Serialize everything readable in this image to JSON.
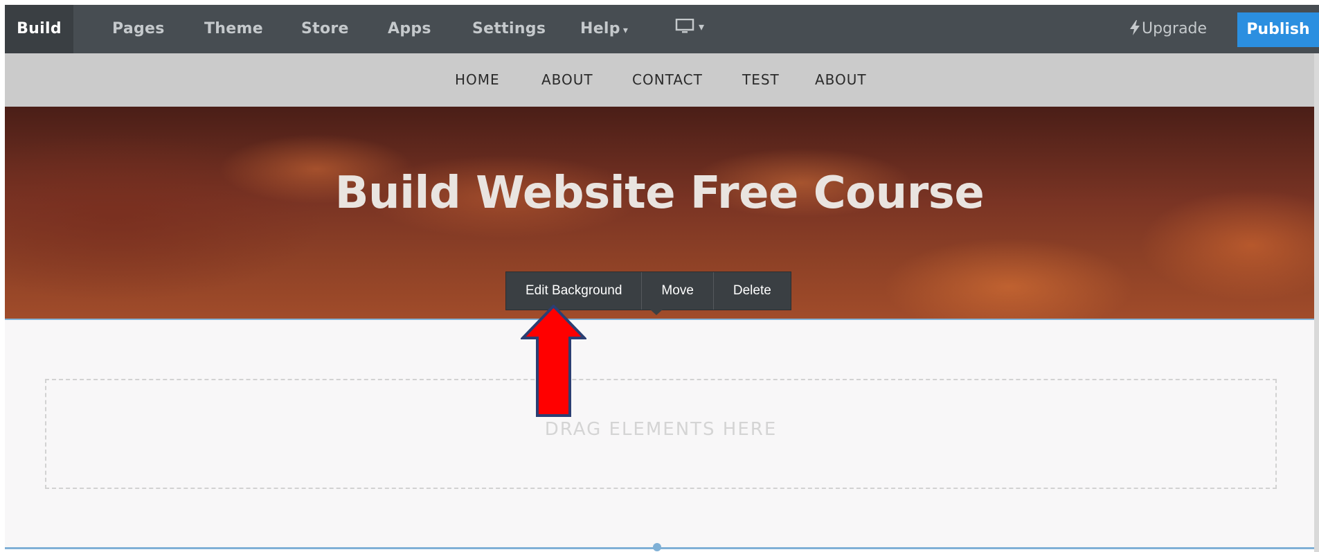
{
  "toolbar": {
    "tabs": [
      {
        "label": "Build",
        "active": true
      },
      {
        "label": "Pages"
      },
      {
        "label": "Theme"
      },
      {
        "label": "Store"
      },
      {
        "label": "Apps"
      },
      {
        "label": "Settings"
      },
      {
        "label": "Help"
      }
    ],
    "device_icon": "monitor-icon",
    "upgrade_label": "Upgrade",
    "upgrade_icon": "lightning-icon",
    "publish_label": "Publish",
    "publish_color": "#2b8fe0"
  },
  "site_nav": {
    "links": [
      "HOME",
      "ABOUT",
      "CONTACT",
      "TEST",
      "ABOUT"
    ]
  },
  "hero": {
    "title": "Build Website Free Course"
  },
  "context_toolbar": {
    "edit_background_label": "Edit Background",
    "move_label": "Move",
    "delete_label": "Delete"
  },
  "dropzone": {
    "text": "DRAG ELEMENTS HERE"
  },
  "annotation": {
    "arrow_color": "#ff0000",
    "arrow_icon": "red-up-arrow"
  }
}
